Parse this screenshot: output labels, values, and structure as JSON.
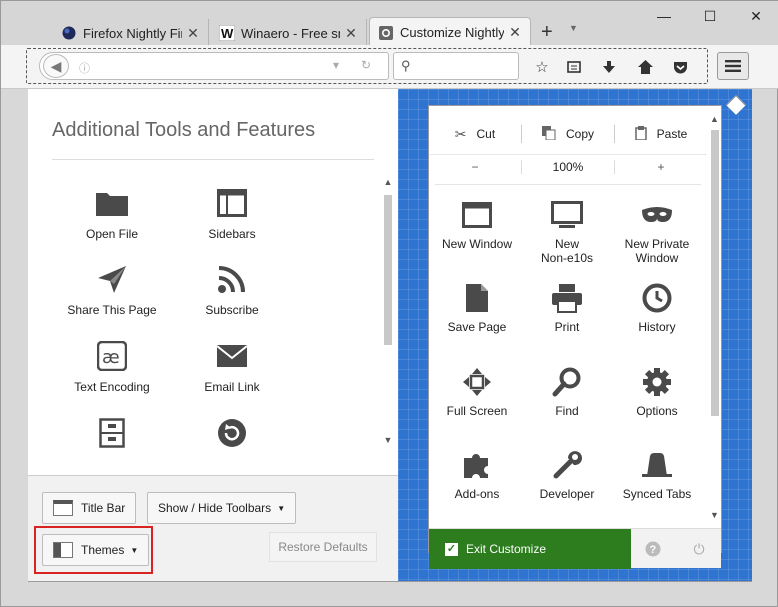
{
  "window": {
    "tabs": [
      {
        "label": "Firefox Nightly First",
        "icon": "firefox-globe-icon"
      },
      {
        "label": "Winaero - Free smal",
        "icon": "winaero-w-icon"
      },
      {
        "label": "Customize Nightly",
        "icon": "gear-icon",
        "active": true
      }
    ],
    "controls": {
      "minimize": "—",
      "maximize": "☐",
      "close": "✕"
    }
  },
  "customize": {
    "palette_title": "Additional Tools and Features",
    "palette_items": [
      {
        "label": "Open File",
        "icon": "folder-icon"
      },
      {
        "label": "Sidebars",
        "icon": "sidebars-icon"
      },
      {
        "label": "Share This Page",
        "icon": "share-paper-plane-icon"
      },
      {
        "label": "Subscribe",
        "icon": "rss-icon"
      },
      {
        "label": "Text Encoding",
        "icon": "text-encoding-icon"
      },
      {
        "label": "Email Link",
        "icon": "email-envelope-icon"
      },
      {
        "label": "",
        "icon": "cabinet-icon"
      },
      {
        "label": "",
        "icon": "forget-restore-icon"
      }
    ],
    "footer": {
      "title_bar": "Title Bar",
      "show_hide_toolbars": "Show / Hide Toolbars",
      "themes": "Themes",
      "restore_defaults": "Restore Defaults"
    }
  },
  "menu_panel": {
    "edit": {
      "cut": "Cut",
      "copy": "Copy",
      "paste": "Paste"
    },
    "zoom": {
      "out": "−",
      "level": "100%",
      "in": "+"
    },
    "items": [
      {
        "label": "New Window",
        "icon": "new-window-icon"
      },
      {
        "label": "New\nNon-e10s",
        "icon": "monitor-icon"
      },
      {
        "label": "New Private\nWindow",
        "icon": "private-mask-icon"
      },
      {
        "label": "Save Page",
        "icon": "save-page-icon"
      },
      {
        "label": "Print",
        "icon": "printer-icon"
      },
      {
        "label": "History",
        "icon": "clock-icon"
      },
      {
        "label": "Full Screen",
        "icon": "fullscreen-arrows-icon"
      },
      {
        "label": "Find",
        "icon": "magnifier-icon"
      },
      {
        "label": "Options",
        "icon": "gear-icon"
      },
      {
        "label": "Add-ons",
        "icon": "puzzle-icon"
      },
      {
        "label": "Developer",
        "icon": "wrench-icon"
      },
      {
        "label": "Synced Tabs",
        "icon": "synced-tabs-icon"
      }
    ],
    "exit_customize": "Exit Customize",
    "help": "?",
    "quit": "⏻"
  },
  "colors": {
    "blueprint": "#2f74d0",
    "exit_green": "#2d7d1f",
    "highlight_red": "#d82323"
  }
}
